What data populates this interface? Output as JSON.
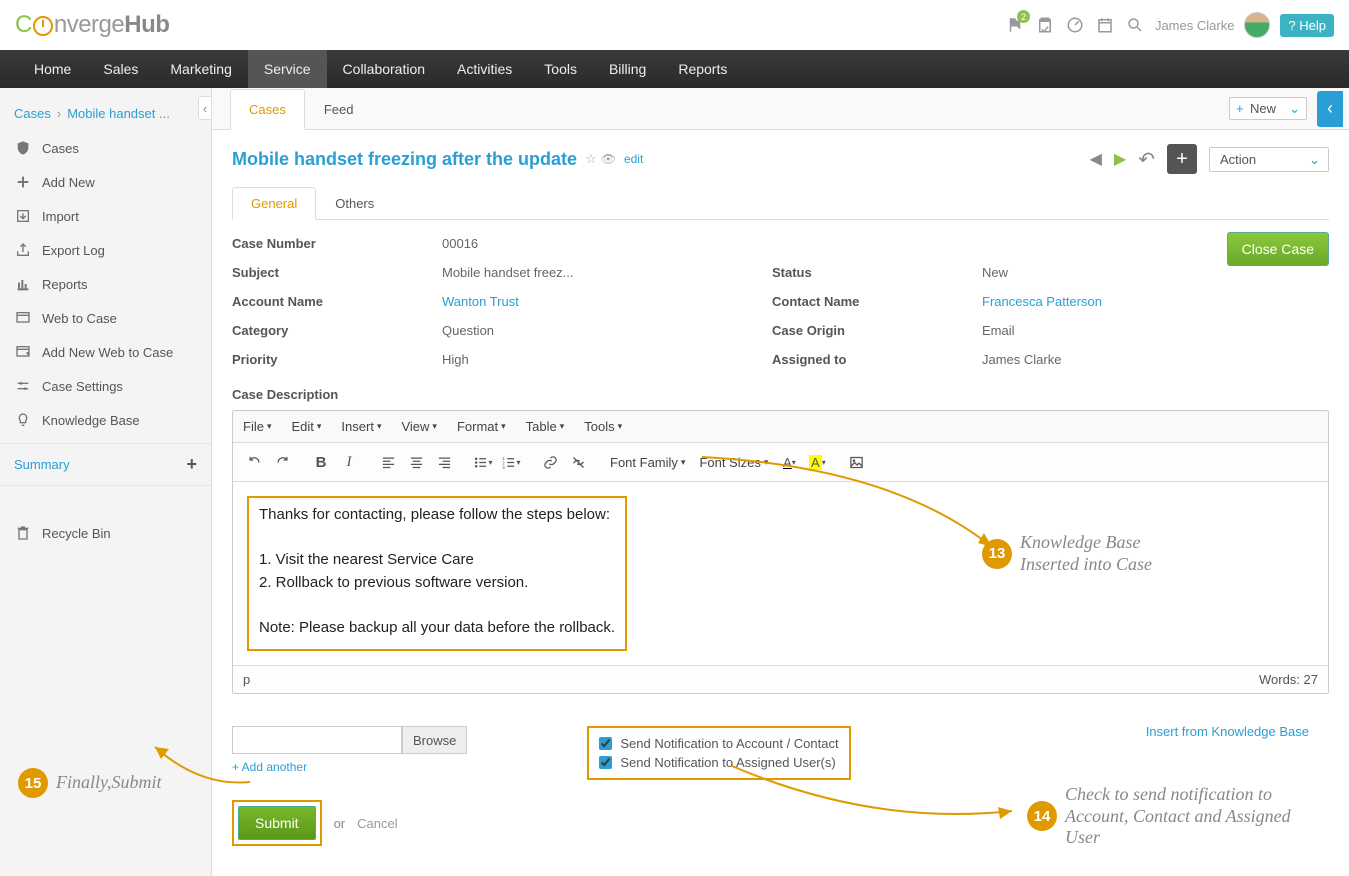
{
  "header": {
    "logo_part_c": "C",
    "logo_part_onverge": "nverge",
    "logo_part_hub": "Hub",
    "flag_badge": "2",
    "username": "James Clarke",
    "help_label": "? Help"
  },
  "mainnav": {
    "items": [
      "Home",
      "Sales",
      "Marketing",
      "Service",
      "Collaboration",
      "Activities",
      "Tools",
      "Billing",
      "Reports"
    ],
    "active_index": 3
  },
  "breadcrumb": {
    "root": "Cases",
    "current": "Mobile handset ..."
  },
  "sidebar": {
    "items": [
      {
        "label": "Cases",
        "icon": "shield"
      },
      {
        "label": "Add New",
        "icon": "plus"
      },
      {
        "label": "Import",
        "icon": "import"
      },
      {
        "label": "Export Log",
        "icon": "export"
      },
      {
        "label": "Reports",
        "icon": "chart"
      },
      {
        "label": "Web to Case",
        "icon": "web"
      },
      {
        "label": "Add New Web to Case",
        "icon": "webplus"
      },
      {
        "label": "Case Settings",
        "icon": "sliders"
      },
      {
        "label": "Knowledge Base",
        "icon": "bulb"
      }
    ],
    "summary_label": "Summary",
    "recycle_label": "Recycle Bin"
  },
  "tabs": {
    "items": [
      "Cases",
      "Feed"
    ],
    "active_index": 0,
    "new_label": "New"
  },
  "title": {
    "text": "Mobile handset freezing after the update",
    "edit": "edit",
    "action_label": "Action"
  },
  "subtabs": {
    "items": [
      "General",
      "Others"
    ],
    "active_index": 0
  },
  "close_case_label": "Close Case",
  "fields": {
    "case_number": {
      "label": "Case Number",
      "value": "00016"
    },
    "subject": {
      "label": "Subject",
      "value": "Mobile handset freez..."
    },
    "status": {
      "label": "Status",
      "value": "New"
    },
    "account_name": {
      "label": "Account Name",
      "value": "Wanton Trust"
    },
    "contact_name": {
      "label": "Contact Name",
      "value": "Francesca Patterson"
    },
    "category": {
      "label": "Category",
      "value": "Question"
    },
    "case_origin": {
      "label": "Case Origin",
      "value": "Email"
    },
    "priority": {
      "label": "Priority",
      "value": "High"
    },
    "assigned_to": {
      "label": "Assigned to",
      "value": "James Clarke"
    }
  },
  "description": {
    "label": "Case Description",
    "menus": [
      "File",
      "Edit",
      "Insert",
      "View",
      "Format",
      "Table",
      "Tools"
    ],
    "toolbar_dd": [
      "Font Family",
      "Font Sizes"
    ],
    "body_line1": "Thanks for contacting, please follow the steps below:",
    "body_line2": "1. Visit the nearest Service Care",
    "body_line3": "2. Rollback to previous software version.",
    "body_line4": "Note: Please backup all your data before the rollback.",
    "path": "p",
    "words": "Words: 27"
  },
  "below": {
    "browse": "Browse",
    "add_another": "+ Add another",
    "notif1": "Send Notification to Account / Contact",
    "notif2": "Send Notification to Assigned User(s)",
    "kb_link": "Insert from Knowledge Base"
  },
  "submit": {
    "button": "Submit",
    "or": "or",
    "cancel": "Cancel"
  },
  "annotations": {
    "a13_num": "13",
    "a13_text": "Knowledge Base Inserted into Case",
    "a14_num": "14",
    "a14_text": "Check to send notification to Account, Contact and Assigned User",
    "a15_num": "15",
    "a15_text": "Finally,Submit"
  }
}
